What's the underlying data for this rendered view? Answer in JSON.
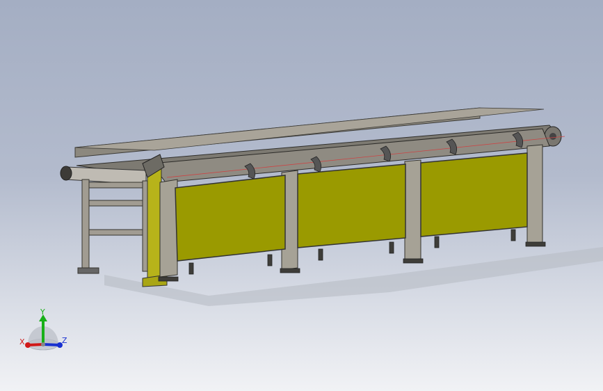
{
  "viewport": {
    "background_top": "#a4aec3",
    "background_bottom": "#f1f2f5"
  },
  "model": {
    "frame_color": "#9a958b",
    "guard_panel_color": "#9a9a00",
    "panel_count": 3
  },
  "triad": {
    "x_label": "X",
    "y_label": "Y",
    "z_label": "Z",
    "x_color": "#d01818",
    "y_color": "#18b018",
    "z_color": "#1830d0"
  }
}
